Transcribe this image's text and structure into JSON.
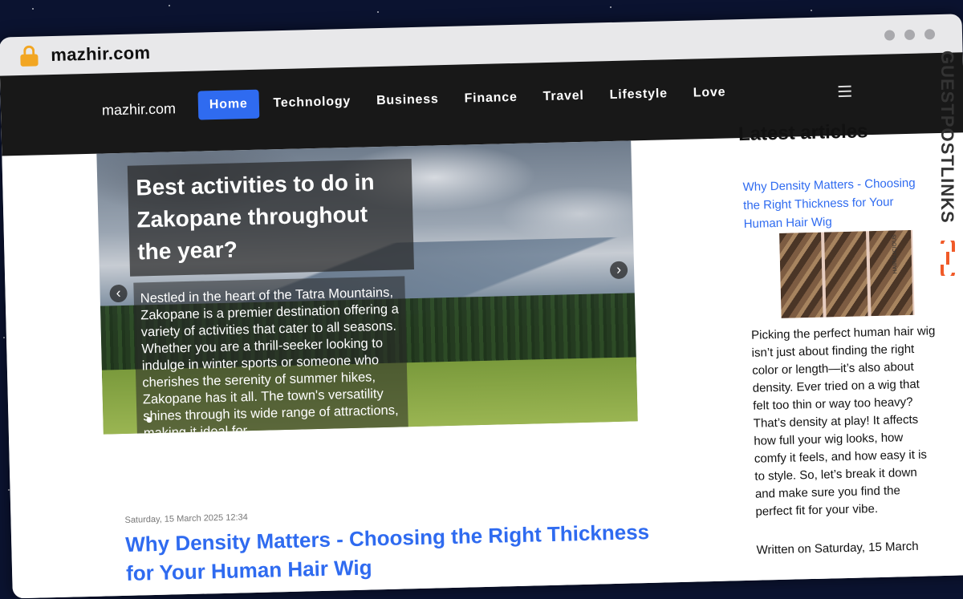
{
  "browser": {
    "url": "mazhir.com"
  },
  "nav": {
    "brand": "mazhir.com",
    "items": [
      {
        "label": "Home",
        "active": true
      },
      {
        "label": "Technology",
        "active": false
      },
      {
        "label": "Business",
        "active": false
      },
      {
        "label": "Finance",
        "active": false
      },
      {
        "label": "Travel",
        "active": false
      },
      {
        "label": "Lifestyle",
        "active": false
      },
      {
        "label": "Love",
        "active": false
      }
    ]
  },
  "hero": {
    "title": "Best activities to do in Zakopane throughout the year?",
    "text": "Nestled in the heart of the Tatra Mountains, Zakopane is a premier destination offering a variety of activities that cater to all seasons. Whether you are a thrill-seeker looking to indulge in winter sports or someone who cherishes the serenity of summer hikes, Zakopane has it all. The town's versatility shines through its wide range of attractions, making it ideal for"
  },
  "post": {
    "date": "Saturday, 15 March 2025 12:34",
    "title": "Why Density Matters - Choosing the Right Thickness for Your Human Hair Wig"
  },
  "sidebar": {
    "heading": "Latest articles",
    "article_title": "Why Density Matters - Choosing the Right Thickness for Your Human Hair Wig",
    "image_caption": "HAIRALICIOUS",
    "article_text": "Picking the perfect human hair wig isn’t just about finding the right color or length—it’s also about density. Ever tried on a wig that felt too thin or way too heavy? That’s density at play! It affects how full your wig looks, how comfy it feels, and how easy it is to style. So, let’s break it down and make sure you find the perfect fit for your vibe.",
    "meta": "Written on Saturday, 15 March"
  },
  "badge": {
    "text": "GUESTPOSTLINKS"
  },
  "colors": {
    "accent": "#2f6bf0",
    "navbar": "#181818",
    "lock": "#f2a623",
    "badge_logo": "#f05a28"
  }
}
